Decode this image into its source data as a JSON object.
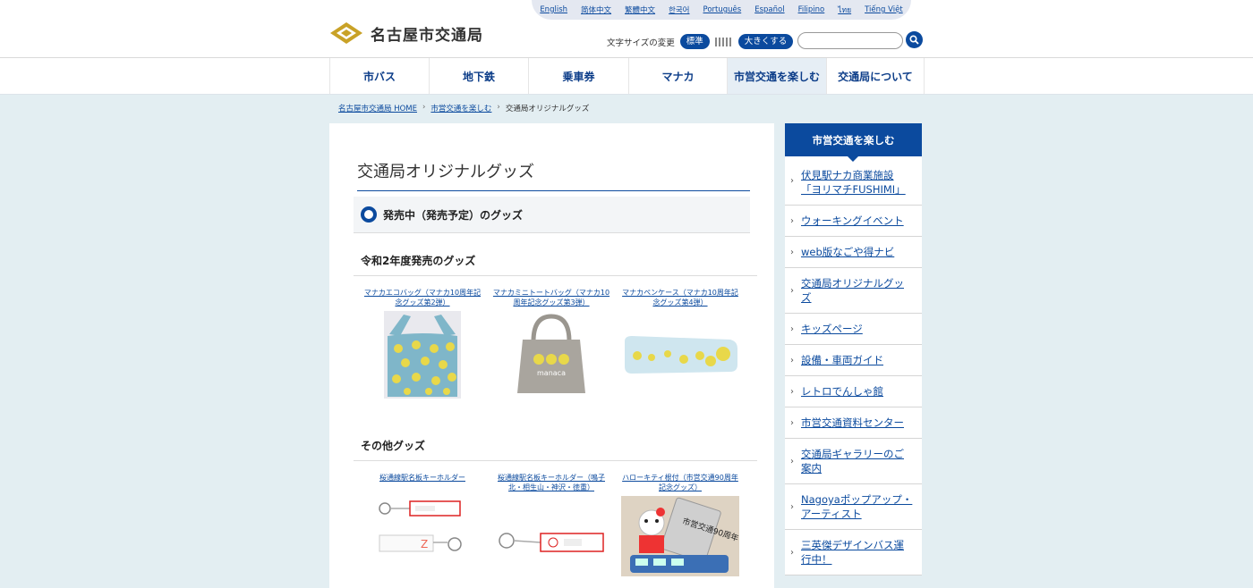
{
  "languages": [
    "English",
    "简体中文",
    "繁體中文",
    "한국어",
    "Português",
    "Español",
    "Filipino",
    "ไทย",
    "Tiếng Việt"
  ],
  "logo": {
    "name": "名古屋市交通局"
  },
  "text_size": {
    "label": "文字サイズの変更",
    "standard": "標準",
    "larger": "大きくする"
  },
  "search": {
    "placeholder": ""
  },
  "nav": [
    "市バス",
    "地下鉄",
    "乗車券",
    "マナカ",
    "市営交通を楽しむ",
    "交通局について"
  ],
  "breadcrumb": [
    "名古屋市交通局 HOME",
    "市営交通を楽しむ",
    "交通局オリジナルグッズ"
  ],
  "main": {
    "title": "交通局オリジナルグッズ",
    "section_heading": "発売中（発売予定）のグッズ",
    "subsections": [
      {
        "heading": "令和2年度発売のグッズ",
        "items": [
          "マナカエコバッグ（マナカ10周年記念グッズ第2弾）",
          "マナカミニトートバッグ（マナカ10周年記念グッズ第3弾）",
          "マナカペンケース（マナカ10周年記念グッズ第4弾）"
        ],
        "manaca_print": "manaca"
      },
      {
        "heading": "その他グッズ",
        "items": [
          "桜通線駅名板キーホルダー",
          "桜通線駅名板キーホルダー（鳴子北・相生山・神沢・徳重）",
          "ハローキティ根付（市営交通90周年記念グッズ）"
        ],
        "charm_print": "市営交通90周年"
      }
    ]
  },
  "sidebar": {
    "heading": "市営交通を楽しむ",
    "items": [
      "伏見駅ナカ商業施設「ヨリマチFUSHIMI」",
      "ウォーキングイベント",
      "web版なごや得ナビ",
      "交通局オリジナルグッズ",
      "キッズページ",
      "設備・車両ガイド",
      "レトロでんしゃ館",
      "市営交通資料センター",
      "交通局ギャラリーのご案内",
      "Nagoyaポップアップ・アーティスト",
      "三英傑デザインバス運行中！"
    ]
  },
  "colors": {
    "brand_blue": "#0b4a9e",
    "background": "#e3eef2",
    "logo_gold": "#c9a227"
  }
}
